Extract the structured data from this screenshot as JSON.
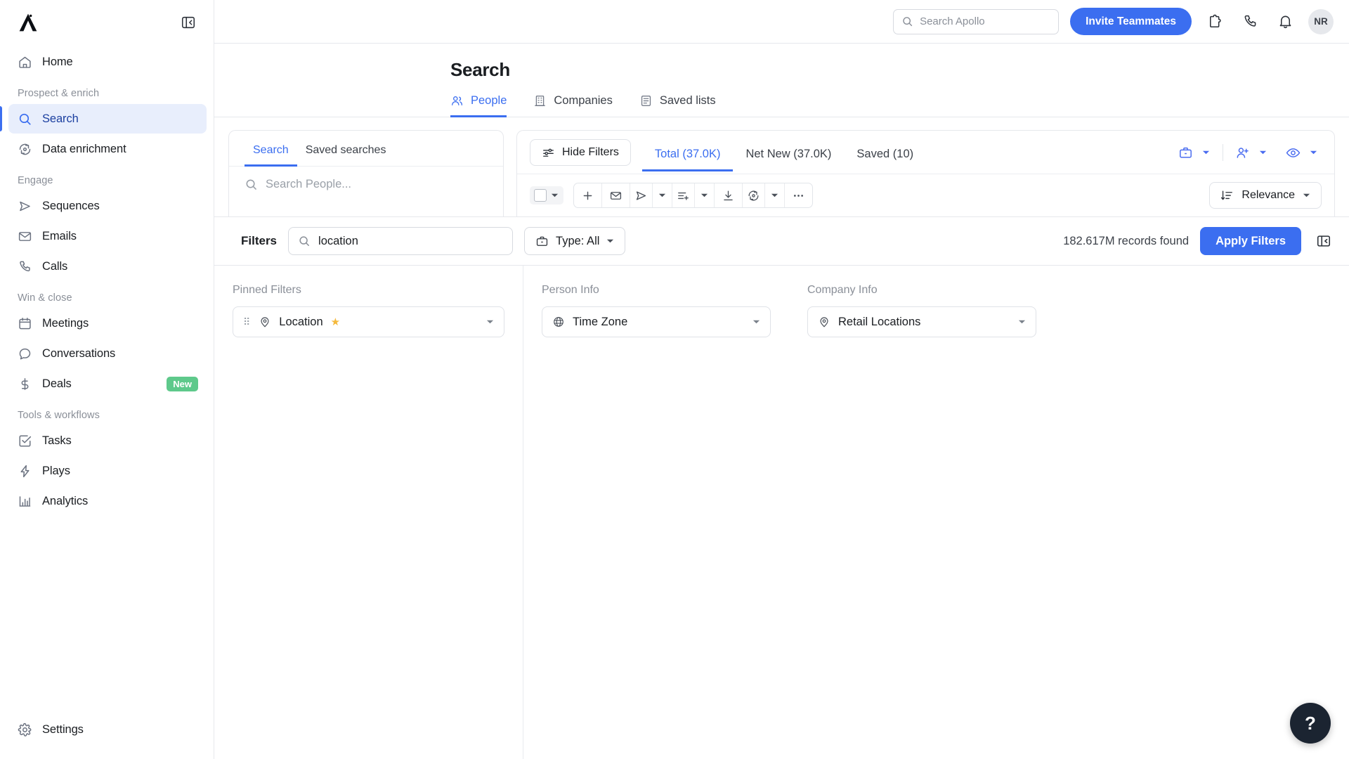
{
  "sidebar": {
    "logo_name": "apollo-logo",
    "collapse_icon": "panel-collapse-icon",
    "home": {
      "label": "Home",
      "icon": "home-icon"
    },
    "groups": [
      {
        "label": "Prospect & enrich",
        "items": [
          {
            "label": "Search",
            "icon": "search-icon",
            "active": true
          },
          {
            "label": "Data enrichment",
            "icon": "refresh-data-icon",
            "active": false
          }
        ]
      },
      {
        "label": "Engage",
        "items": [
          {
            "label": "Sequences",
            "icon": "send-icon",
            "active": false
          },
          {
            "label": "Emails",
            "icon": "mail-icon",
            "active": false
          },
          {
            "label": "Calls",
            "icon": "phone-icon",
            "active": false
          }
        ]
      },
      {
        "label": "Win & close",
        "items": [
          {
            "label": "Meetings",
            "icon": "calendar-icon",
            "active": false
          },
          {
            "label": "Conversations",
            "icon": "chat-bubble-icon",
            "active": false
          },
          {
            "label": "Deals",
            "icon": "dollar-icon",
            "active": false,
            "badge": "New"
          }
        ]
      },
      {
        "label": "Tools & workflows",
        "items": [
          {
            "label": "Tasks",
            "icon": "checkbox-task-icon",
            "active": false
          },
          {
            "label": "Plays",
            "icon": "lightning-icon",
            "active": false
          },
          {
            "label": "Analytics",
            "icon": "bar-chart-icon",
            "active": false
          }
        ]
      }
    ],
    "settings": {
      "label": "Settings",
      "icon": "gear-icon"
    }
  },
  "topbar": {
    "search_placeholder": "Search Apollo",
    "search_value": "",
    "search_icon": "search-icon",
    "invite_label": "Invite Teammates",
    "icons": [
      "puzzle-extension-icon",
      "phone-icon",
      "bell-notification-icon"
    ],
    "avatar_initials": "NR"
  },
  "page": {
    "title": "Search",
    "tabs": [
      {
        "label": "People",
        "icon": "people-icon",
        "active": true
      },
      {
        "label": "Companies",
        "icon": "building-icon",
        "active": false
      },
      {
        "label": "Saved lists",
        "icon": "list-icon",
        "active": false
      }
    ]
  },
  "left_panel": {
    "tabs": [
      {
        "label": "Search",
        "active": true
      },
      {
        "label": "Saved searches",
        "active": false
      }
    ],
    "search_placeholder": "Search People...",
    "search_value": "",
    "search_icon": "search-icon"
  },
  "results_toolbar": {
    "hide_filters_label": "Hide Filters",
    "hide_filters_icon": "sliders-icon",
    "segments": [
      {
        "label": "Total (37.0K)",
        "active": true
      },
      {
        "label": "Net New (37.0K)",
        "active": false
      },
      {
        "label": "Saved (10)",
        "active": false
      }
    ],
    "right_icons": [
      {
        "name": "briefcase-icon",
        "has_caret": true
      },
      {
        "name": "add-person-icon",
        "has_caret": true
      },
      {
        "name": "eye-icon",
        "has_caret": true
      }
    ],
    "select_all_checkbox": false,
    "actions": [
      {
        "name": "plus-icon",
        "has_caret": false
      },
      {
        "name": "mail-icon",
        "has_caret": false
      },
      {
        "name": "send-icon",
        "has_caret": true
      },
      {
        "name": "add-to-list-icon",
        "has_caret": true
      },
      {
        "name": "download-icon",
        "has_caret": false
      },
      {
        "name": "refresh-data-icon",
        "has_caret": true
      },
      {
        "name": "more-options-icon",
        "has_caret": false
      }
    ],
    "sort": {
      "label": "Relevance",
      "icon": "sort-descending-icon"
    }
  },
  "filters_bar": {
    "label": "Filters",
    "search_value": "location",
    "search_placeholder": "",
    "search_icon": "search-icon",
    "type_label": "Type: All",
    "type_icon": "briefcase-icon",
    "records_found": "182.617M records found",
    "apply_label": "Apply Filters",
    "collapse_icon": "panel-collapse-icon"
  },
  "filter_columns": [
    {
      "title": "Pinned Filters",
      "filters": [
        {
          "label": "Location",
          "icon": "location-pin-icon",
          "pinned": true,
          "draggable": true
        }
      ]
    },
    {
      "title": "Person Info",
      "filters": [
        {
          "label": "Time Zone",
          "icon": "globe-icon",
          "pinned": false,
          "draggable": false
        }
      ]
    },
    {
      "title": "Company Info",
      "filters": [
        {
          "label": "Retail Locations",
          "icon": "location-pin-icon",
          "pinned": false,
          "draggable": false
        }
      ]
    }
  ],
  "help": {
    "label": "?",
    "icon": "help-icon"
  },
  "colors": {
    "accent_blue": "#3b6ef0",
    "active_bg": "#e8eefc",
    "badge_green": "#5ec98b",
    "pin_gold": "#f5b93c",
    "border": "#e6e8ec"
  }
}
